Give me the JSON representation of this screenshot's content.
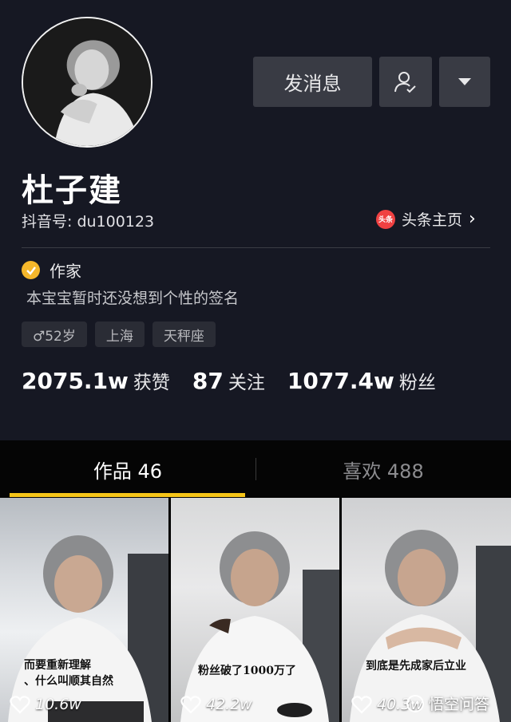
{
  "profile": {
    "name": "杜子建",
    "account_id": "抖音号: du100123",
    "toutiao_label": "头条主页",
    "toutiao_logo_text": "头条",
    "verification": "作家",
    "signature": "本宝宝暂时还没想到个性的签名"
  },
  "actions": {
    "message_label": "发消息"
  },
  "tags": [
    "♂52岁",
    "上海",
    "天秤座"
  ],
  "stats": [
    {
      "value": "2075.1w",
      "label": "获赞"
    },
    {
      "value": "87",
      "label": "关注"
    },
    {
      "value": "1077.4w",
      "label": "粉丝"
    }
  ],
  "tabs": [
    {
      "label": "作品 46"
    },
    {
      "label": "喜欢 488"
    }
  ],
  "videos": [
    {
      "caption": "而要重新理解\n、什么叫顺其自然",
      "likes": "10.6w"
    },
    {
      "caption": "粉丝破了1000万了",
      "likes": "42.2w"
    },
    {
      "caption": "到底是先成家后立业",
      "likes": "40.3w"
    }
  ],
  "watermark": "悟空问答",
  "colors": {
    "background": "#161823",
    "button": "#393b44",
    "tab_indicator": "#f5c518",
    "verify_badge": "#f5b72b",
    "toutiao_logo": "#f04142"
  }
}
